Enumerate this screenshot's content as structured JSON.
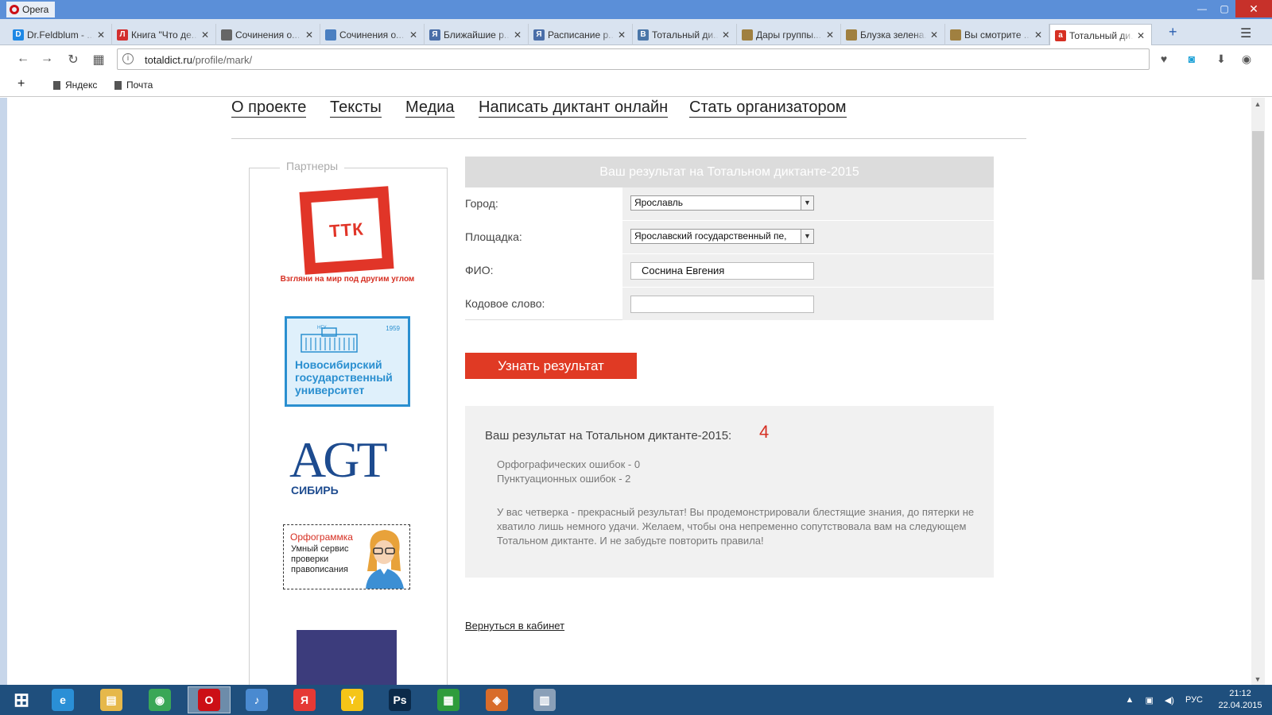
{
  "window": {
    "app_name": "Opera",
    "controls": [
      "—",
      "▢",
      "✕"
    ]
  },
  "tabs": [
    {
      "label": "Dr.Feldblum - ...",
      "icon": "D",
      "color": "#1e88e5"
    },
    {
      "label": "Книга \"Что де...",
      "icon": "Л",
      "color": "#d32f2f"
    },
    {
      "label": "Сочинения о...",
      "icon": "",
      "color": "#666666"
    },
    {
      "label": "Сочинения о...",
      "icon": "",
      "color": "#4a7fc1"
    },
    {
      "label": "Ближайшие р...",
      "icon": "Я",
      "color": "#4a6ea8"
    },
    {
      "label": "Расписание р...",
      "icon": "Я",
      "color": "#4a6ea8"
    },
    {
      "label": "Тотальный ди...",
      "icon": "В",
      "color": "#4a76a8"
    },
    {
      "label": "Дары группы...",
      "icon": "",
      "color": "#a08040"
    },
    {
      "label": "Блузка зелена...",
      "icon": "",
      "color": "#a08040"
    },
    {
      "label": "Вы смотрите ...",
      "icon": "",
      "color": "#a08040"
    },
    {
      "label": "Тотальный ди...",
      "icon": "а",
      "color": "#d62f22"
    }
  ],
  "address": {
    "host": "totaldict.ru",
    "path": "/profile/mark/"
  },
  "bookmarks": [
    "Яндекс",
    "Почта"
  ],
  "site_nav": [
    "О проекте",
    "Тексты",
    "Медиа",
    "Написать диктант онлайн",
    "Стать организатором"
  ],
  "partners": {
    "title": "Партнеры",
    "ttk": {
      "logo": "ТТК",
      "slogan": "Взгляни на мир под другим углом"
    },
    "ngu": {
      "abbr": "НГУ",
      "year": "1959",
      "name": "Новосибирский государственный университет"
    },
    "agt": {
      "letters": "AGT",
      "sub": "СИБИРЬ"
    },
    "orfo": {
      "name": "Орфограммка",
      "desc": "Умный сервис проверки правописания"
    }
  },
  "form": {
    "header": "Ваш результат на Тотальном диктанте-2015",
    "city": {
      "label": "Город:",
      "value": "Ярославль"
    },
    "venue": {
      "label": "Площадка:",
      "value": "Ярославский государственный пе,"
    },
    "name": {
      "label": "ФИО:",
      "value": "Соснина Евгения"
    },
    "code": {
      "label": "Кодовое слово:",
      "value": ""
    },
    "submit": "Узнать результат"
  },
  "result": {
    "label": "Ваш результат на Тотальном диктанте-2015:",
    "score": "4",
    "spelling": "Орфографических ошибок - 0",
    "punctuation": "Пунктуационных ошибок - 2",
    "message": "У вас четверка - прекрасный результат! Вы продемонстрировали блестящие знания, до пятерки не хватило лишь немного удачи. Желаем, чтобы она непременно сопутствовала вам на следующем Тотальном диктанте. И не забудьте повторить правила!"
  },
  "back_link": "Вернуться в кабинет",
  "taskbar": {
    "apps": [
      {
        "name": "windows-start",
        "symbol": "⊞",
        "color": "transparent"
      },
      {
        "name": "internet-explorer",
        "symbol": "e",
        "color": "#2a8fd6"
      },
      {
        "name": "file-explorer",
        "symbol": "▤",
        "color": "#e6b84a"
      },
      {
        "name": "chrome",
        "symbol": "◉",
        "color": "#3aa757"
      },
      {
        "name": "opera",
        "symbol": "O",
        "color": "#cc0f16"
      },
      {
        "name": "media-player",
        "symbol": "♪",
        "color": "#4a8ad0"
      },
      {
        "name": "yandex",
        "symbol": "Я",
        "color": "#e53935"
      },
      {
        "name": "yandex-browser",
        "symbol": "Y",
        "color": "#f5c518"
      },
      {
        "name": "photoshop",
        "symbol": "Ps",
        "color": "#0b2a4a"
      },
      {
        "name": "store",
        "symbol": "▦",
        "color": "#2e9c3c"
      },
      {
        "name": "viewer",
        "symbol": "◈",
        "color": "#d86c2a"
      },
      {
        "name": "calculator",
        "symbol": "▥",
        "color": "#8aa0b8"
      }
    ],
    "lang": "РУС",
    "time": "21:12",
    "date": "22.04.2015"
  }
}
